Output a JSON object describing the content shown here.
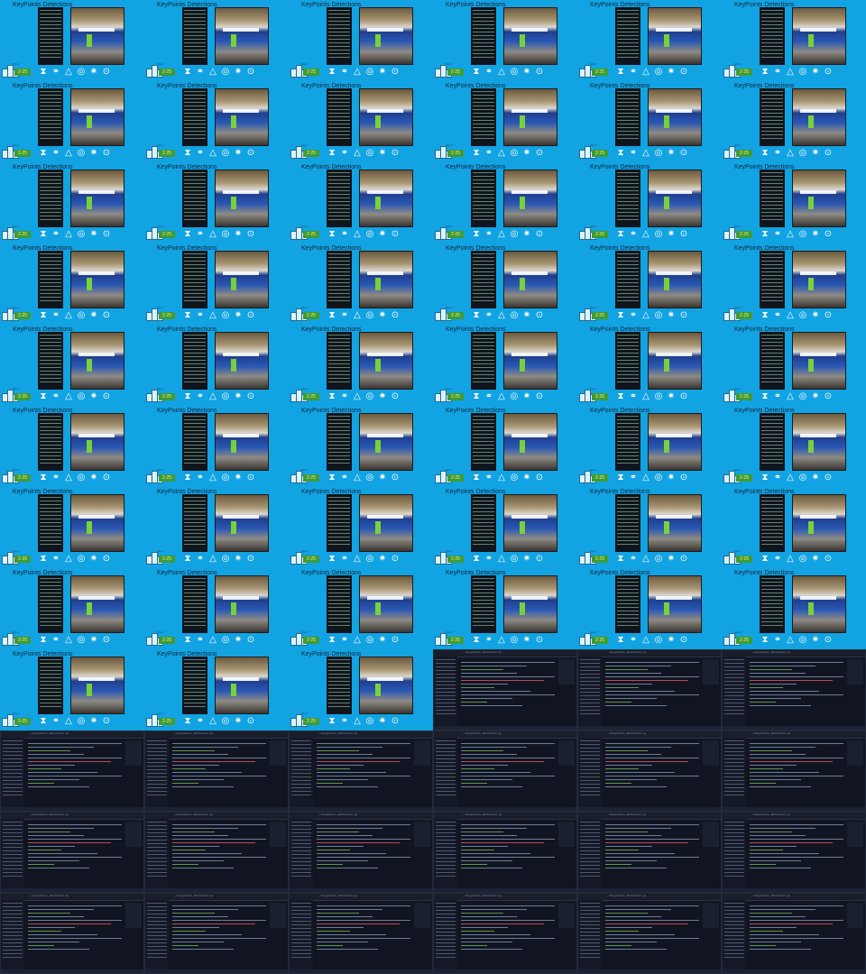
{
  "contact_sheet": {
    "slides": {
      "title": "KeyPoints Detections",
      "url": "https://",
      "logo_text": "2·25",
      "icons": [
        "hourglass-icon",
        "link-icon",
        "triangle-icon",
        "target-icon",
        "gear-icon",
        "eye-icon"
      ],
      "count": 51
    },
    "editor_frames": {
      "file_path": "~/keypoints_detection.py",
      "count": 21
    }
  }
}
